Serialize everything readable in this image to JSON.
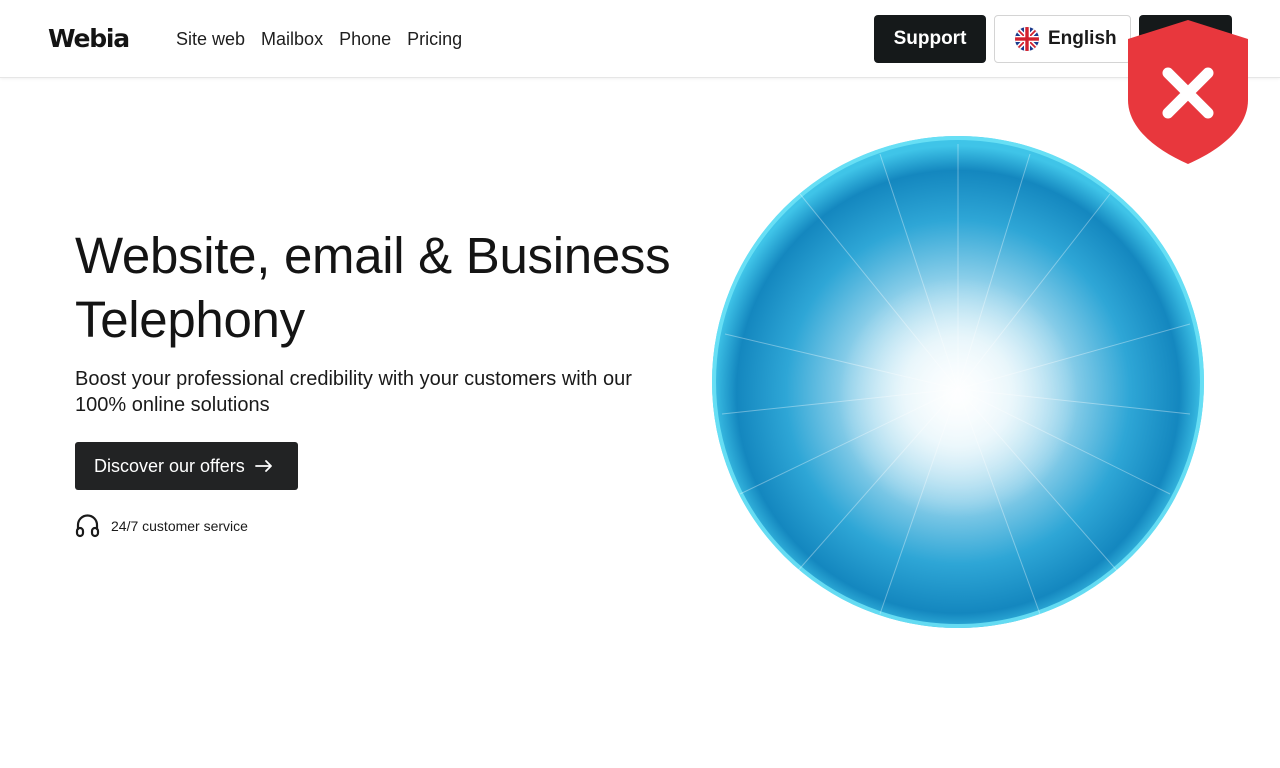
{
  "header": {
    "logo": "Webia",
    "nav": [
      "Site web",
      "Mailbox",
      "Phone",
      "Pricing"
    ],
    "support_label": "Support",
    "language_label": "English",
    "language_flag": "uk-flag-icon"
  },
  "overlay": {
    "icon": "shield-close-icon",
    "color": "#e8373d"
  },
  "hero": {
    "title": "Website, email & Business Telephony",
    "subtitle": "Boost your professional credibility with your customers with our 100% online solutions",
    "cta_label": "Discover our offers",
    "cta_icon": "arrow-right-icon",
    "service_icon": "headset-icon",
    "service_label": "24/7 customer service",
    "image": "glowing-blue-sphere"
  },
  "colors": {
    "primary_dark": "#15191a",
    "cta_bg": "#222324",
    "accent_blue": "#1aa7d6"
  }
}
